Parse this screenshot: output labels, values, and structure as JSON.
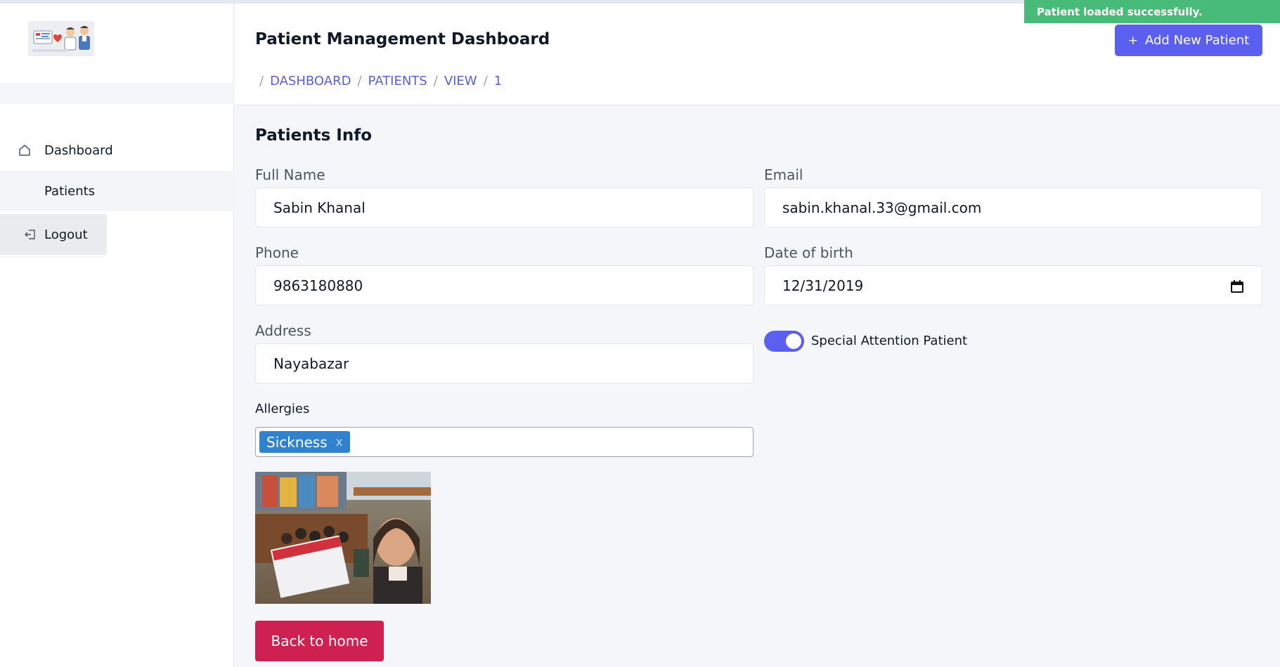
{
  "toast": {
    "message": "Patient loaded successfully."
  },
  "header": {
    "title": "Patient Management Dashboard",
    "add_button_label": "Add New Patient",
    "breadcrumb": [
      "DASHBOARD",
      "PATIENTS",
      "VIEW",
      "1"
    ]
  },
  "sidebar": {
    "items": [
      {
        "label": "Dashboard",
        "icon": "home-icon"
      },
      {
        "label": "Patients"
      },
      {
        "label": "Logout",
        "icon": "logout-icon"
      }
    ]
  },
  "form": {
    "section_title": "Patients Info",
    "full_name": {
      "label": "Full Name",
      "value": "Sabin Khanal"
    },
    "email": {
      "label": "Email",
      "value": "sabin.khanal.33@gmail.com"
    },
    "phone": {
      "label": "Phone",
      "value": "9863180880"
    },
    "dob": {
      "label": "Date of birth",
      "value": "12/31/2019"
    },
    "address": {
      "label": "Address",
      "value": "Nayabazar"
    },
    "special_attention": {
      "label": "Special Attention Patient",
      "checked": true
    },
    "allergies": {
      "label": "Allergies",
      "tags": [
        "Sickness"
      ],
      "remove_glyph": "x"
    },
    "back_button_label": "Back to home"
  },
  "colors": {
    "accent": "#5b5fef",
    "toast": "#48bb78",
    "danger": "#ce2151",
    "tag": "#3182ce"
  }
}
